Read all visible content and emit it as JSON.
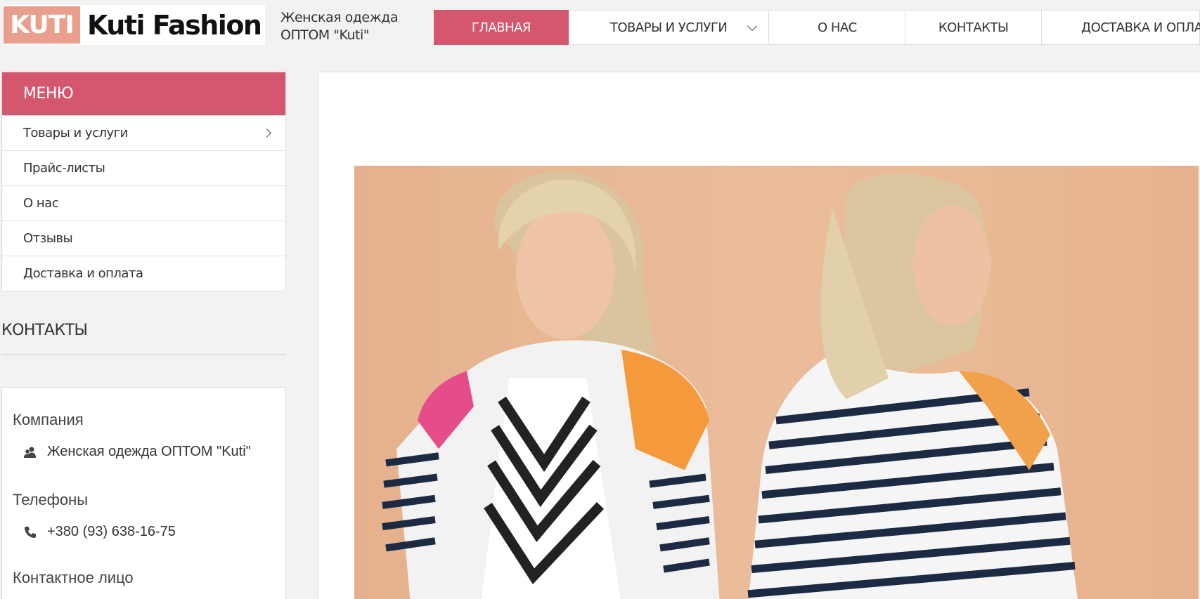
{
  "header": {
    "logo_badge": "KUTI",
    "logo_text": "Kuti Fashion",
    "tagline": "Женская одежда ОПТОМ \"Kuti\""
  },
  "nav": {
    "items": [
      {
        "label": "ГЛАВНАЯ",
        "active": true
      },
      {
        "label": "ТОВАРЫ И УСЛУГИ",
        "has_dropdown": true
      },
      {
        "label": "О НАС"
      },
      {
        "label": "КОНТАКТЫ"
      },
      {
        "label": "ДОСТАВКА И ОПЛАТА"
      }
    ]
  },
  "sidebar": {
    "menu_title": "МЕНЮ",
    "items": [
      {
        "label": "Товары и услуги",
        "has_submenu": true
      },
      {
        "label": "Прайс-листы"
      },
      {
        "label": "О нас"
      },
      {
        "label": "Отзывы"
      },
      {
        "label": "Доставка и оплата"
      }
    ],
    "contacts_title": "КОНТАКТЫ",
    "contact_card": {
      "company_label": "Компания",
      "company_value": "Женская одежда ОПТОМ \"Kuti\"",
      "phones_label": "Телефоны",
      "phone_value": "+380 (93) 638-16-75",
      "contact_person_label": "Контактное лицо"
    }
  },
  "colors": {
    "accent": "#d5566f",
    "logo_badge": "#e99f8b",
    "banner_bg": "#e8b591"
  },
  "icons": {
    "company": "people-icon",
    "phone": "phone-icon"
  }
}
